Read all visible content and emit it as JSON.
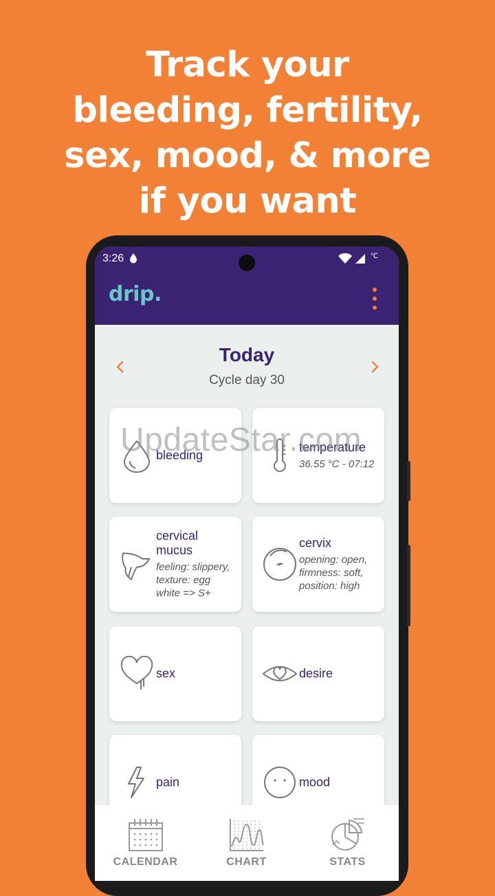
{
  "headline": {
    "lines": [
      "Track your",
      "bleeding, fertility,",
      "sex, mood, & more",
      "if you want"
    ]
  },
  "status_bar": {
    "time": "3:26",
    "network_label": "℃"
  },
  "app_bar": {
    "logo": "drip.",
    "menu_icon": "more-vertical-icon"
  },
  "day_header": {
    "title": "Today",
    "subtitle": "Cycle day 30"
  },
  "cards": [
    {
      "title": "bleeding",
      "detail": "",
      "icon": "drop-icon"
    },
    {
      "title": "temperature",
      "detail": "36.55 °C - 07:12",
      "icon": "thermometer-icon"
    },
    {
      "title": "cervical mucus",
      "detail": "feeling: slippery, texture: egg white => S+",
      "icon": "mucus-icon"
    },
    {
      "title": "cervix",
      "detail": "opening: open, firmness: soft, position: high",
      "icon": "cervix-icon"
    },
    {
      "title": "sex",
      "detail": "",
      "icon": "heart-icon"
    },
    {
      "title": "desire",
      "detail": "",
      "icon": "eye-heart-icon"
    },
    {
      "title": "pain",
      "detail": "",
      "icon": "lightning-icon"
    },
    {
      "title": "mood",
      "detail": "",
      "icon": "face-icon"
    }
  ],
  "watermark": "UpdateStar.com",
  "bottom_nav": [
    {
      "label": "CALENDAR",
      "icon": "calendar-icon"
    },
    {
      "label": "CHART",
      "icon": "chart-icon"
    },
    {
      "label": "STATS",
      "icon": "pie-chart-icon"
    }
  ],
  "colors": {
    "background": "#F28136",
    "primary": "#3A2373",
    "logo": "#69C6C9",
    "accent": "#F28136",
    "screen_bg": "#EBF0EE"
  }
}
